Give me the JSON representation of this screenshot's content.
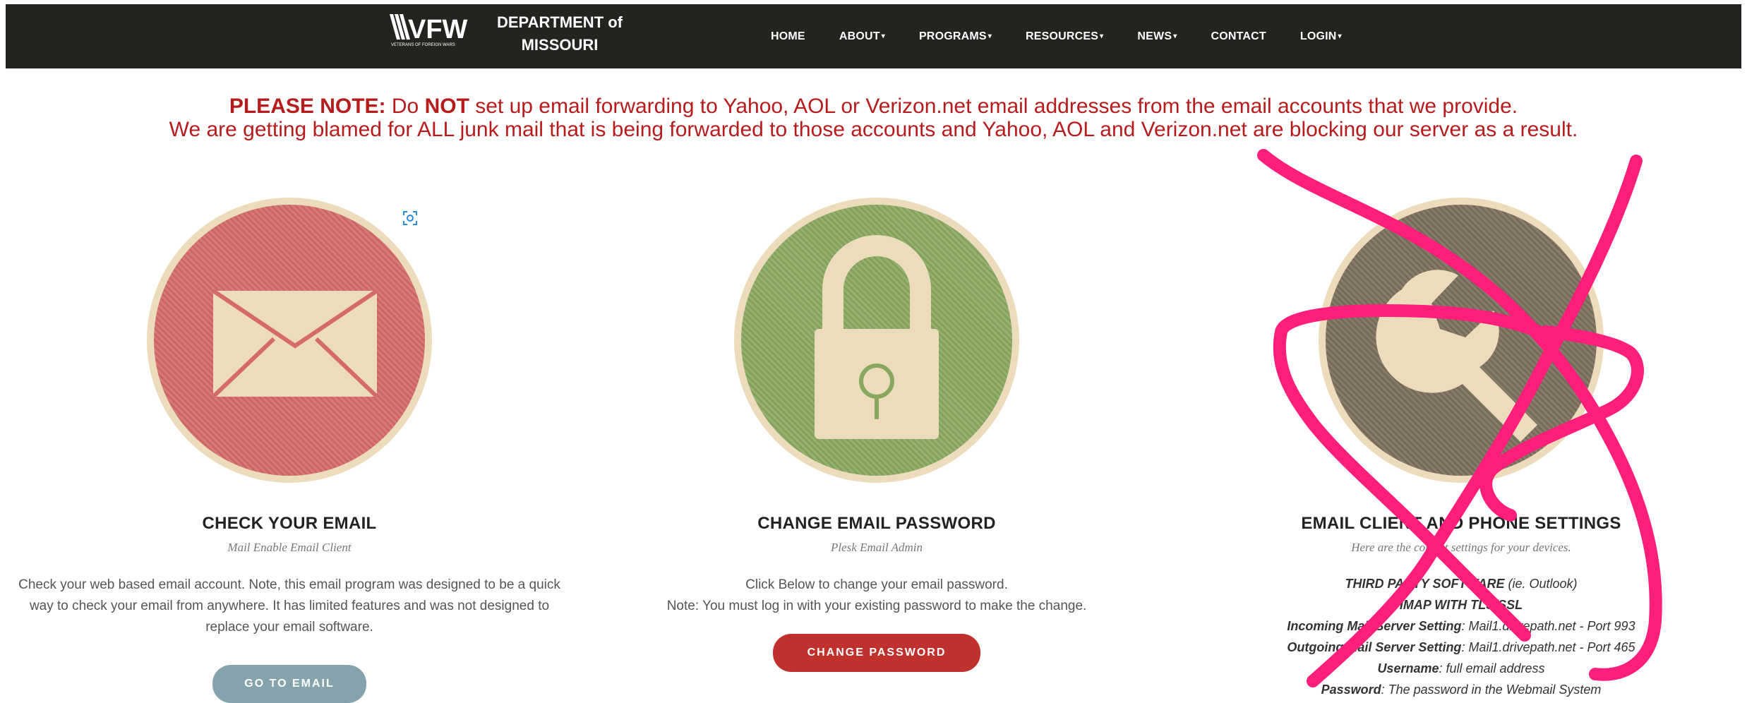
{
  "header": {
    "logo_mark": "VFW",
    "logo_tagline": "VETERANS OF FOREIGN WARS",
    "org_line1": "DEPARTMENT of",
    "org_line2": "MISSOURI",
    "nav": [
      {
        "label": "HOME",
        "caret": false
      },
      {
        "label": "ABOUT",
        "caret": true
      },
      {
        "label": "PROGRAMS",
        "caret": true
      },
      {
        "label": "RESOURCES",
        "caret": true
      },
      {
        "label": "NEWS",
        "caret": true
      },
      {
        "label": "CONTACT",
        "caret": false
      },
      {
        "label": "LOGIN",
        "caret": true
      }
    ]
  },
  "notice": {
    "lead": "PLEASE NOTE:",
    "t1": " Do ",
    "strong": "NOT",
    "t2": " set up email forwarding to Yahoo, AOL or Verizon.net email addresses from the email accounts that we provide.",
    "line2": "We are getting blamed for ALL junk mail that is being forwarded to those accounts and Yahoo, AOL and Verizon.net are blocking our server as a result."
  },
  "columns": {
    "email": {
      "title": "CHECK YOUR EMAIL",
      "subtitle": "Mail Enable Email Client",
      "desc": "Check your web based email account.  Note, this email program was designed to be a quick way to check your email from anywhere.  It has limited features and was not designed to replace your email software.",
      "button": "GO TO EMAIL",
      "icon": "envelope-icon",
      "color": "#d46a6a"
    },
    "password": {
      "title": "CHANGE EMAIL PASSWORD",
      "subtitle": "Plesk Email Admin",
      "desc1": "Click Below to change your email password.",
      "desc2": "Note:  You must log in with your existing password to make the change.",
      "button": "CHANGE PASSWORD",
      "icon": "padlock-icon",
      "color": "#88a860"
    },
    "settings": {
      "title": "EMAIL CLIENT AND PHONE SETTINGS",
      "subtitle": "Here are the correct settings for your devices.",
      "lines": [
        {
          "label": "THIRD PARTY SOFTWARE",
          "value": " (ie. Outlook)"
        },
        {
          "label": "IMAP WITH TLS/SSL",
          "value": ""
        },
        {
          "label": "Incoming Mail Server Setting",
          "value": ": Mail1.drivepath.net - Port 993"
        },
        {
          "label": "Outgoing Mail Server Setting",
          "value": ": Mail1.drivepath.net - Port 465"
        },
        {
          "label": "Username",
          "value": ":  full email address"
        },
        {
          "label": "Password",
          "value": ": The password in the Webmail System"
        }
      ],
      "icon": "wrench-icon",
      "color": "#7b6e5c"
    }
  },
  "annotation": {
    "color": "#ff1f7a",
    "icon": "pink-x-scribble"
  }
}
